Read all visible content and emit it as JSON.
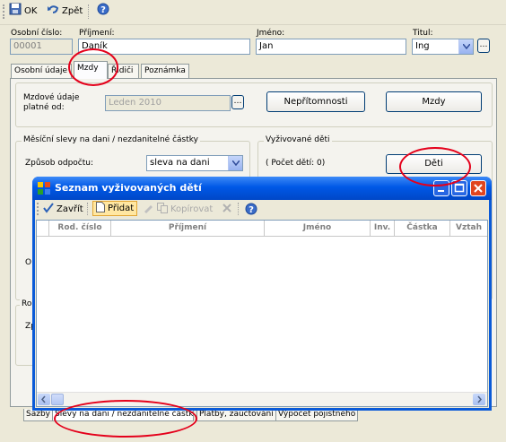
{
  "toolbar": {
    "ok_label": "OK",
    "back_label": "Zpět"
  },
  "header": {
    "personal_number_label": "Osobní číslo:",
    "personal_number_value": "00001",
    "surname_label": "Příjmení:",
    "surname_value": "Daník",
    "name_label": "Jméno:",
    "name_value": "Jan",
    "title_label": "Titul:",
    "title_value": "Ing"
  },
  "tabs": [
    "Osobní údaje",
    "Mzdy",
    "Řidiči",
    "Poznámka"
  ],
  "mzdy": {
    "valid_from_label_line1": "Mzdové údaje",
    "valid_from_label_line2": "platné od:",
    "valid_from_value": "Leden 2010",
    "absence_button": "Nepřítomnosti",
    "wages_button": "Mzdy"
  },
  "tax_group": {
    "title": "Měsíční slevy na dani / nezdanitelné částky",
    "method_label": "Způsob odpočtu:",
    "method_value": "sleva na dani",
    "partial_label_o": "O",
    "partial_label_ro": "Ro",
    "partial_label_zp": "Zp"
  },
  "children_group": {
    "title": "Vyživované děti",
    "count_label": "( Počet dětí:  0)",
    "children_button": "Děti"
  },
  "dialog": {
    "title": "Seznam vyživovaných dětí",
    "toolbar": {
      "close_label": "Zavřít",
      "add_label": "Přidat",
      "copy_label": "Kopírovat"
    },
    "columns": [
      "Rod. číslo",
      "Příjmení",
      "Jméno",
      "Inv. grad",
      "Částka",
      "Vztah"
    ]
  },
  "bottom_tabs": [
    "Sazby",
    "Slevy na dani / nezdanitelné částky",
    "Platby, zaúčtování",
    "Výpočet pojistného"
  ],
  "colors": {
    "annotation": "#e4001b",
    "xp_title": "#0a5ad8"
  }
}
